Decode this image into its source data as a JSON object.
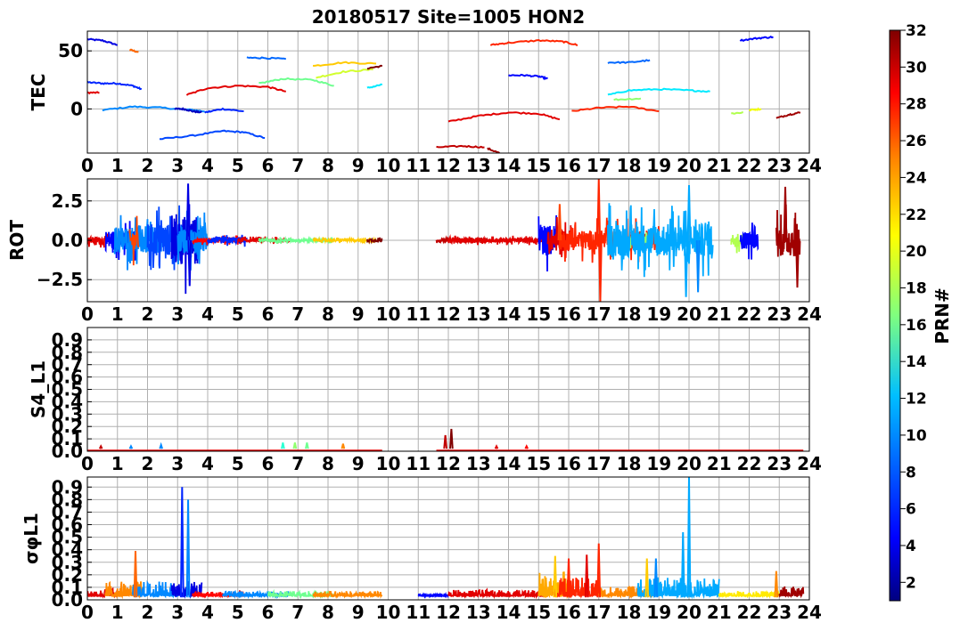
{
  "title": "20180517 Site=1005 HON2",
  "colors": {
    "grid": "#b0b0b0",
    "jet": [
      "#00007f",
      "#0000ff",
      "#007fff",
      "#00ffff",
      "#7fff7f",
      "#ffff00",
      "#ff7f00",
      "#ff0000",
      "#7f0000"
    ]
  },
  "colorbar": {
    "label": "PRN#",
    "min": 1,
    "max": 32,
    "ticks": [
      "2",
      "4",
      "6",
      "8",
      "10",
      "12",
      "14",
      "16",
      "18",
      "20",
      "22",
      "24",
      "26",
      "28",
      "30",
      "32"
    ]
  },
  "chart_data": [
    {
      "type": "line",
      "ylabel": "TEC",
      "xlim": [
        0,
        24
      ],
      "ylim": [
        -38,
        67
      ],
      "xticks": [
        "0",
        "1",
        "2",
        "3",
        "4",
        "5",
        "6",
        "7",
        "8",
        "9",
        "10",
        "11",
        "12",
        "13",
        "14",
        "15",
        "16",
        "17",
        "18",
        "19",
        "20",
        "21",
        "22",
        "23",
        "24"
      ],
      "yticks": [
        {
          "v": 50,
          "t": "50"
        },
        {
          "v": 0,
          "t": "0"
        }
      ],
      "series": [
        {
          "prn": 4,
          "x": [
            0,
            0.5,
            1.0
          ],
          "y": [
            60,
            59,
            55
          ]
        },
        {
          "prn": 25,
          "x": [
            1.4,
            1.7
          ],
          "y": [
            51,
            49
          ]
        },
        {
          "prn": 6,
          "x": [
            0,
            0.5,
            1.0,
            1.5,
            1.8
          ],
          "y": [
            23,
            22,
            22,
            20,
            17
          ]
        },
        {
          "prn": 29,
          "x": [
            0,
            0.4
          ],
          "y": [
            14,
            14
          ]
        },
        {
          "prn": 9,
          "x": [
            0.5,
            1.5,
            2.5,
            3.5,
            3.9
          ],
          "y": [
            -1,
            2,
            1,
            -1,
            -2
          ]
        },
        {
          "prn": 3,
          "x": [
            2.9,
            3.2,
            3.5,
            3.8
          ],
          "y": [
            0,
            0,
            -2,
            -3
          ]
        },
        {
          "prn": 6,
          "x": [
            3.9,
            4.5,
            5.2
          ],
          "y": [
            -3,
            0,
            -2
          ]
        },
        {
          "prn": 7,
          "x": [
            2.4,
            3.5,
            4.5,
            5.2,
            5.9
          ],
          "y": [
            -26,
            -23,
            -19,
            -20,
            -25
          ]
        },
        {
          "prn": 29,
          "x": [
            3.3,
            4.0,
            5.0,
            6.0,
            6.6
          ],
          "y": [
            12,
            18,
            20,
            19,
            15
          ]
        },
        {
          "prn": 8,
          "x": [
            5.3,
            5.8,
            6.6
          ],
          "y": [
            44,
            44,
            43
          ]
        },
        {
          "prn": 16,
          "x": [
            5.7,
            6.5,
            7.5,
            8.2
          ],
          "y": [
            22,
            26,
            25,
            20
          ]
        },
        {
          "prn": 22,
          "x": [
            7.5,
            8.5,
            9.6
          ],
          "y": [
            37,
            40,
            39
          ]
        },
        {
          "prn": 19,
          "x": [
            7.6,
            8.5,
            9.5
          ],
          "y": [
            27,
            32,
            34
          ]
        },
        {
          "prn": 32,
          "x": [
            9.3,
            9.8
          ],
          "y": [
            35,
            37
          ]
        },
        {
          "prn": 12,
          "x": [
            9.3,
            9.8
          ],
          "y": [
            18,
            21
          ]
        },
        {
          "prn": 30,
          "x": [
            11.6,
            12.5,
            13.2
          ],
          "y": [
            -33,
            -32,
            -33
          ]
        },
        {
          "prn": 31,
          "x": [
            13.3,
            13.7
          ],
          "y": [
            -34,
            -38
          ]
        },
        {
          "prn": 29,
          "x": [
            12.0,
            13.0,
            14.0,
            15.0,
            15.7
          ],
          "y": [
            -11,
            -6,
            -3,
            -4,
            -9
          ]
        },
        {
          "prn": 27,
          "x": [
            13.4,
            14.0,
            15.0,
            15.8,
            16.3
          ],
          "y": [
            55,
            57,
            59,
            58,
            55
          ]
        },
        {
          "prn": 5,
          "x": [
            14.0,
            14.5,
            15.0,
            15.3
          ],
          "y": [
            29,
            29,
            28,
            26
          ]
        },
        {
          "prn": 27,
          "x": [
            16.1,
            17.0,
            18.0,
            19.0
          ],
          "y": [
            -2,
            1,
            2,
            -2
          ]
        },
        {
          "prn": 8,
          "x": [
            17.3,
            18.0,
            18.7
          ],
          "y": [
            40,
            40,
            42
          ]
        },
        {
          "prn": 12,
          "x": [
            17.3,
            18.0,
            19.0,
            20.0,
            20.7
          ],
          "y": [
            12,
            16,
            17,
            16,
            15
          ]
        },
        {
          "prn": 17,
          "x": [
            17.5,
            18.4
          ],
          "y": [
            8,
            9
          ]
        },
        {
          "prn": 18,
          "x": [
            21.4,
            21.8
          ],
          "y": [
            -4,
            -3
          ]
        },
        {
          "prn": 20,
          "x": [
            22.0,
            22.4
          ],
          "y": [
            -1,
            0
          ]
        },
        {
          "prn": 5,
          "x": [
            21.7,
            22.3,
            22.8
          ],
          "y": [
            59,
            61,
            62
          ]
        },
        {
          "prn": 31,
          "x": [
            22.9,
            23.3,
            23.7
          ],
          "y": [
            -8,
            -5,
            -3
          ]
        }
      ]
    },
    {
      "type": "line",
      "ylabel": "ROT",
      "xlim": [
        0,
        24
      ],
      "ylim": [
        -3.9,
        3.9
      ],
      "xticks": [
        "0",
        "1",
        "2",
        "3",
        "4",
        "5",
        "6",
        "7",
        "8",
        "9",
        "10",
        "11",
        "12",
        "13",
        "14",
        "15",
        "16",
        "17",
        "18",
        "19",
        "20",
        "21",
        "22",
        "23",
        "24"
      ],
      "yticks": [
        {
          "v": 2.5,
          "t": "2.5"
        },
        {
          "v": 0,
          "t": "0.0"
        },
        {
          "v": -2.5,
          "t": "−2.5"
        }
      ],
      "noisy": [
        {
          "prn": 29,
          "x0": 0.0,
          "x1": 1.0,
          "amp": 0.3
        },
        {
          "prn": 5,
          "x0": 0.6,
          "x1": 1.6,
          "amp": 0.9
        },
        {
          "prn": 9,
          "x0": 0.9,
          "x1": 2.5,
          "amp": 1.3
        },
        {
          "prn": 26,
          "x0": 1.4,
          "x1": 1.7,
          "amp": 1.0
        },
        {
          "prn": 7,
          "x0": 2.0,
          "x1": 3.2,
          "amp": 1.5
        },
        {
          "prn": 4,
          "x0": 2.8,
          "x1": 3.7,
          "amp": 2.2
        },
        {
          "prn": 9,
          "x0": 3.0,
          "x1": 4.0,
          "amp": 1.2
        },
        {
          "prn": 28,
          "x0": 3.5,
          "x1": 5.2,
          "amp": 0.2
        },
        {
          "prn": 6,
          "x0": 4.0,
          "x1": 5.3,
          "amp": 0.3
        },
        {
          "prn": 29,
          "x0": 5.0,
          "x1": 6.8,
          "amp": 0.15
        },
        {
          "prn": 16,
          "x0": 5.7,
          "x1": 8.2,
          "amp": 0.15
        },
        {
          "prn": 22,
          "x0": 7.5,
          "x1": 9.6,
          "amp": 0.12
        },
        {
          "prn": 32,
          "x0": 9.3,
          "x1": 9.8,
          "amp": 0.12
        },
        {
          "prn": 30,
          "x0": 11.6,
          "x1": 13.3,
          "amp": 0.12
        },
        {
          "prn": 29,
          "x0": 12.0,
          "x1": 15.7,
          "amp": 0.2
        },
        {
          "prn": 5,
          "x0": 15.0,
          "x1": 15.6,
          "amp": 1.4
        },
        {
          "prn": 29,
          "x0": 15.3,
          "x1": 16.1,
          "amp": 1.0
        },
        {
          "prn": 27,
          "x0": 15.7,
          "x1": 19.0,
          "amp": 0.9
        },
        {
          "prn": 17,
          "x0": 17.5,
          "x1": 18.6,
          "amp": 0.4
        },
        {
          "prn": 10,
          "x0": 17.3,
          "x1": 20.8,
          "amp": 1.5
        },
        {
          "prn": 18,
          "x0": 21.4,
          "x1": 21.9,
          "amp": 0.6
        },
        {
          "prn": 5,
          "x0": 21.7,
          "x1": 22.3,
          "amp": 0.8
        },
        {
          "prn": 31,
          "x0": 22.9,
          "x1": 23.7,
          "amp": 1.5
        }
      ],
      "spikes": [
        {
          "prn": 4,
          "x": 3.35,
          "y": 3.6
        },
        {
          "prn": 4,
          "x": 3.4,
          "y": -2.9
        },
        {
          "prn": 26,
          "x": 15.7,
          "y": 2.3
        },
        {
          "prn": 27,
          "x": 17.0,
          "y": 3.9
        },
        {
          "prn": 27,
          "x": 17.05,
          "y": -3.9
        },
        {
          "prn": 10,
          "x": 19.9,
          "y": -3.6
        },
        {
          "prn": 10,
          "x": 20.0,
          "y": 3.5
        },
        {
          "prn": 31,
          "x": 23.2,
          "y": 3.4
        },
        {
          "prn": 31,
          "x": 23.6,
          "y": -3.0
        },
        {
          "prn": 9,
          "x": 20.3,
          "y": -3.3
        }
      ]
    },
    {
      "type": "line",
      "ylabel": "S4_L1",
      "xlim": [
        0,
        24
      ],
      "ylim": [
        0,
        1.0
      ],
      "xticks": [
        "0",
        "1",
        "2",
        "3",
        "4",
        "5",
        "6",
        "7",
        "8",
        "9",
        "10",
        "11",
        "12",
        "13",
        "14",
        "15",
        "16",
        "17",
        "18",
        "19",
        "20",
        "21",
        "22",
        "23",
        "24"
      ],
      "yticks": [
        {
          "v": 0.0,
          "t": "0.0"
        },
        {
          "v": 0.1,
          "t": "0.1"
        },
        {
          "v": 0.2,
          "t": "0.2"
        },
        {
          "v": 0.3,
          "t": "0.3"
        },
        {
          "v": 0.4,
          "t": "0.4"
        },
        {
          "v": 0.5,
          "t": "0.5"
        },
        {
          "v": 0.6,
          "t": "0.6"
        },
        {
          "v": 0.7,
          "t": "0.7"
        },
        {
          "v": 0.8,
          "t": "0.8"
        },
        {
          "v": 0.9,
          "t": "0.9"
        }
      ],
      "baseline": [
        {
          "prn": 29,
          "x0": 0.0,
          "x1": 9.8,
          "y": 0.005
        },
        {
          "prn": 29,
          "x0": 11.6,
          "x1": 23.8,
          "y": 0.005
        }
      ],
      "spikes": [
        {
          "prn": 30,
          "x": 0.45,
          "y": 0.04
        },
        {
          "prn": 9,
          "x": 1.45,
          "y": 0.04
        },
        {
          "prn": 9,
          "x": 2.45,
          "y": 0.05
        },
        {
          "prn": 14,
          "x": 6.5,
          "y": 0.07
        },
        {
          "prn": 17,
          "x": 6.9,
          "y": 0.07
        },
        {
          "prn": 16,
          "x": 7.3,
          "y": 0.07
        },
        {
          "prn": 24,
          "x": 8.5,
          "y": 0.06
        },
        {
          "prn": 30,
          "x": 11.9,
          "y": 0.13
        },
        {
          "prn": 32,
          "x": 12.1,
          "y": 0.18
        },
        {
          "prn": 29,
          "x": 13.6,
          "y": 0.04
        },
        {
          "prn": 28,
          "x": 14.6,
          "y": 0.04
        }
      ]
    },
    {
      "type": "line",
      "ylabel": "σφL1",
      "xlim": [
        0,
        24
      ],
      "ylim": [
        0,
        0.98
      ],
      "xticks": [
        "0",
        "1",
        "2",
        "3",
        "4",
        "5",
        "6",
        "7",
        "8",
        "9",
        "10",
        "11",
        "12",
        "13",
        "14",
        "15",
        "16",
        "17",
        "18",
        "19",
        "20",
        "21",
        "22",
        "23",
        "24"
      ],
      "yticks": [
        {
          "v": 0.0,
          "t": "0.0"
        },
        {
          "v": 0.1,
          "t": "0.1"
        },
        {
          "v": 0.2,
          "t": "0.2"
        },
        {
          "v": 0.3,
          "t": "0.3"
        },
        {
          "v": 0.4,
          "t": "0.4"
        },
        {
          "v": 0.5,
          "t": "0.5"
        },
        {
          "v": 0.6,
          "t": "0.6"
        },
        {
          "v": 0.7,
          "t": "0.7"
        },
        {
          "v": 0.8,
          "t": "0.8"
        },
        {
          "v": 0.9,
          "t": "0.9"
        }
      ],
      "noisy": [
        {
          "prn": 29,
          "x0": 0.0,
          "x1": 1.0,
          "amp": 0.06
        },
        {
          "prn": 24,
          "x0": 0.6,
          "x1": 1.8,
          "amp": 0.12
        },
        {
          "prn": 9,
          "x0": 1.5,
          "x1": 3.0,
          "amp": 0.12
        },
        {
          "prn": 4,
          "x0": 2.8,
          "x1": 3.8,
          "amp": 0.12
        },
        {
          "prn": 28,
          "x0": 3.5,
          "x1": 5.2,
          "amp": 0.04
        },
        {
          "prn": 9,
          "x0": 4.5,
          "x1": 6.7,
          "amp": 0.04
        },
        {
          "prn": 16,
          "x0": 6.0,
          "x1": 8.2,
          "amp": 0.04
        },
        {
          "prn": 24,
          "x0": 7.5,
          "x1": 9.8,
          "amp": 0.04
        },
        {
          "prn": 5,
          "x0": 11.0,
          "x1": 12.0,
          "amp": 0.02
        },
        {
          "prn": 29,
          "x0": 12.0,
          "x1": 15.3,
          "amp": 0.05
        },
        {
          "prn": 23,
          "x0": 15.0,
          "x1": 16.0,
          "amp": 0.2
        },
        {
          "prn": 27,
          "x0": 15.5,
          "x1": 17.0,
          "amp": 0.15
        },
        {
          "prn": 24,
          "x0": 17.0,
          "x1": 19.0,
          "amp": 0.08
        },
        {
          "prn": 10,
          "x0": 18.3,
          "x1": 21.0,
          "amp": 0.15
        },
        {
          "prn": 21,
          "x0": 21.0,
          "x1": 23.0,
          "amp": 0.04
        },
        {
          "prn": 31,
          "x0": 23.0,
          "x1": 23.8,
          "amp": 0.08
        }
      ],
      "spikes": [
        {
          "prn": 25,
          "x": 1.6,
          "y": 0.39
        },
        {
          "prn": 6,
          "x": 3.15,
          "y": 0.9
        },
        {
          "prn": 9,
          "x": 3.35,
          "y": 0.8
        },
        {
          "prn": 22,
          "x": 15.55,
          "y": 0.35
        },
        {
          "prn": 27,
          "x": 16.0,
          "y": 0.33
        },
        {
          "prn": 29,
          "x": 16.6,
          "y": 0.36
        },
        {
          "prn": 27,
          "x": 17.0,
          "y": 0.45
        },
        {
          "prn": 22,
          "x": 18.6,
          "y": 0.33
        },
        {
          "prn": 9,
          "x": 18.9,
          "y": 0.33
        },
        {
          "prn": 10,
          "x": 19.8,
          "y": 0.54
        },
        {
          "prn": 10,
          "x": 20.0,
          "y": 0.98
        },
        {
          "prn": 24,
          "x": 22.9,
          "y": 0.23
        }
      ]
    }
  ]
}
